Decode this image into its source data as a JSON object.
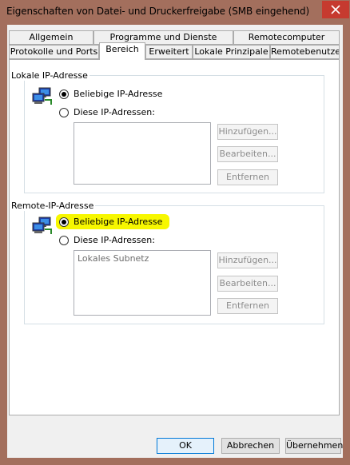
{
  "window": {
    "title": "Eigenschaften von Datei- und Druckerfreigabe (SMB eingehend)"
  },
  "tabs_row1": [
    "Allgemein",
    "Programme und Dienste",
    "Remotecomputer"
  ],
  "tabs_row2": [
    "Protokolle und Ports",
    "Bereich",
    "Erweitert",
    "Lokale Prinzipale",
    "Remotebenutzer"
  ],
  "local": {
    "group_label": "Lokale IP-Adresse",
    "option_any": "Beliebige IP-Adresse",
    "option_these": "Diese IP-Adressen:",
    "selected": "any",
    "list_items": [],
    "buttons": {
      "add": "Hinzufügen...",
      "edit": "Bearbeiten...",
      "remove": "Entfernen"
    }
  },
  "remote": {
    "group_label": "Remote-IP-Adresse",
    "option_any": "Beliebige IP-Adresse",
    "option_these": "Diese IP-Adressen:",
    "selected": "any",
    "highlight_color": "#f7f700",
    "list_items": [
      "Lokales Subnetz"
    ],
    "buttons": {
      "add": "Hinzufügen...",
      "edit": "Bearbeiten...",
      "remove": "Entfernen"
    }
  },
  "dialog_buttons": {
    "ok": "OK",
    "cancel": "Abbrechen",
    "apply": "Übernehmen"
  },
  "colors": {
    "title_bar": "#a36f5d",
    "close_button": "#c63a2f",
    "default_button_border": "#0078d7"
  },
  "icons": {
    "local_icon": "network-computers-icon",
    "remote_icon": "network-computers-icon",
    "close": "close-icon"
  }
}
